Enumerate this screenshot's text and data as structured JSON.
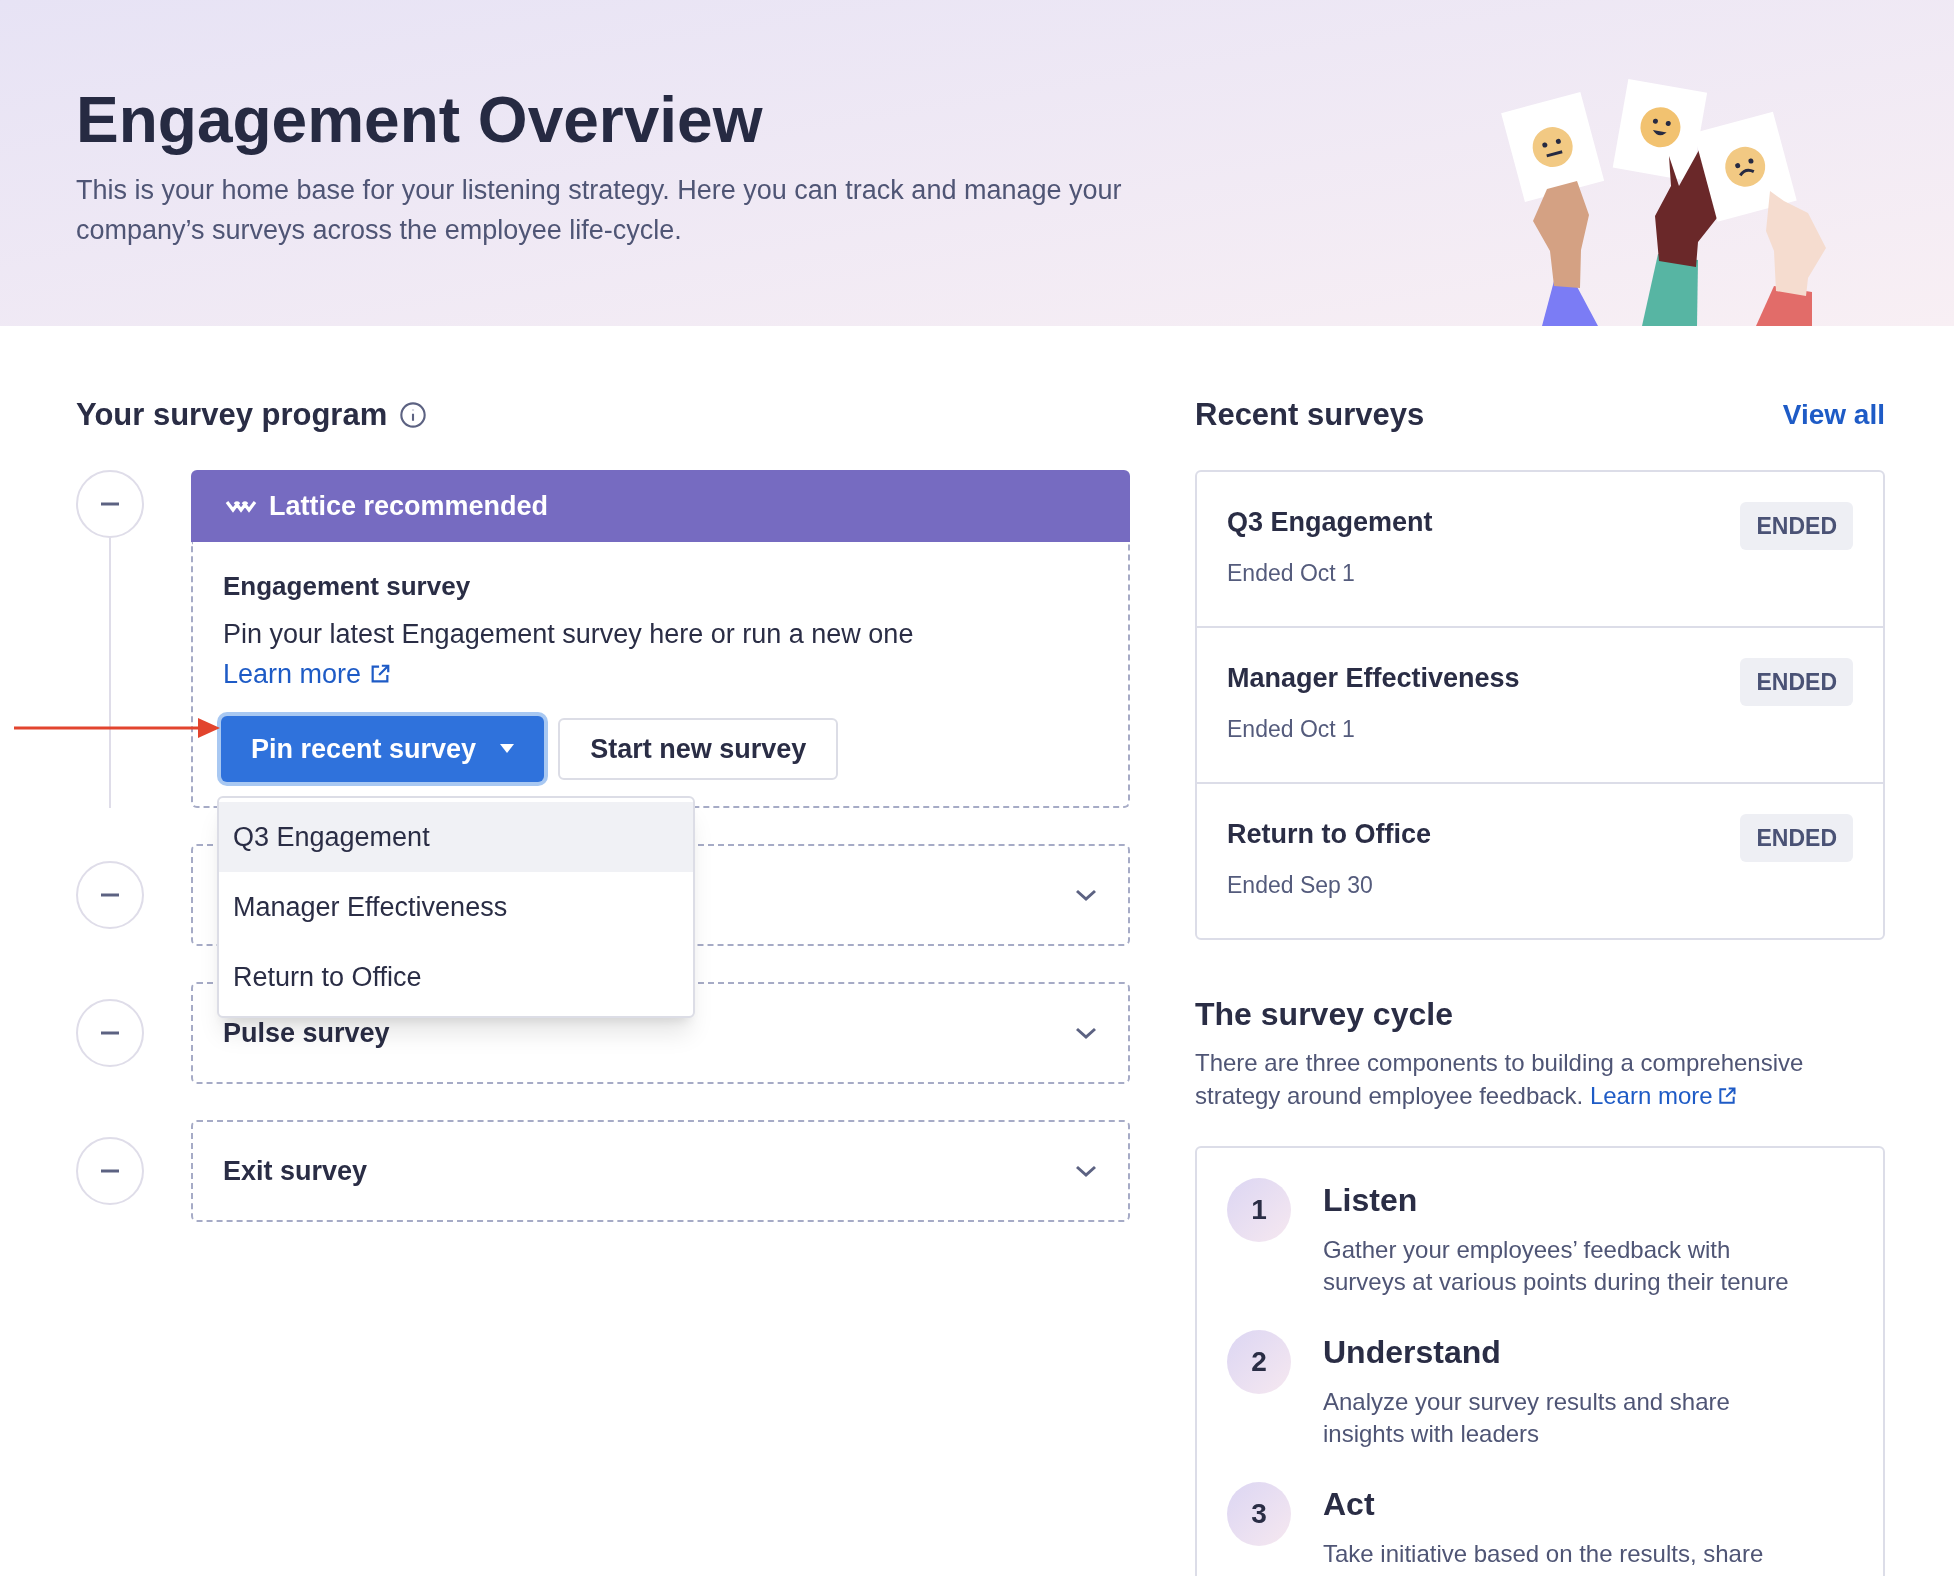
{
  "header": {
    "title": "Engagement Overview",
    "description": "This is your home base for your listening strategy. Here you can track and manage your company’s surveys across the employee life-cycle."
  },
  "program": {
    "title": "Your survey program",
    "stages": [
      {
        "kind": "recommended",
        "banner": "Lattice recommended",
        "title": "Engagement survey",
        "description": "Pin your latest Engagement survey here or run a new one",
        "link": "Learn more",
        "actions": [
          {
            "kind": "dropdown",
            "label": "Pin recent survey",
            "expanded": true
          },
          {
            "kind": "plain",
            "label": "Start new survey"
          }
        ]
      },
      {
        "kind": "collapsed"
      },
      {
        "kind": "collapsed",
        "title": "Pulse survey"
      },
      {
        "kind": "collapsed",
        "title": "Exit survey"
      }
    ],
    "menu": [
      {
        "label": "Q3 Engagement",
        "selected": true
      },
      {
        "label": "Manager Effectiveness",
        "selected": false
      },
      {
        "label": "Return to Office",
        "selected": false
      }
    ]
  },
  "recent": {
    "title": "Recent surveys",
    "view_all": "View all",
    "items": [
      {
        "name": "Q3 Engagement",
        "date": "Ended Oct 1",
        "status": "ENDED"
      },
      {
        "name": "Manager Effectiveness",
        "date": "Ended Oct 1",
        "status": "ENDED"
      },
      {
        "name": "Return to Office",
        "date": "Ended Sep 30",
        "status": "ENDED"
      }
    ]
  },
  "cycle": {
    "title": "The survey cycle",
    "description": "There are three components to building a comprehensive strategy around employee feedback.",
    "link": "Learn more",
    "steps": [
      {
        "number": "1",
        "title": "Listen",
        "description": "Gather your employees’ feedback with surveys at various points during their tenure"
      },
      {
        "number": "2",
        "title": "Understand",
        "description": "Analyze your survey results and share insights with leaders"
      },
      {
        "number": "3",
        "title": "Act",
        "description": "Take initiative based on the results, share"
      }
    ]
  }
}
